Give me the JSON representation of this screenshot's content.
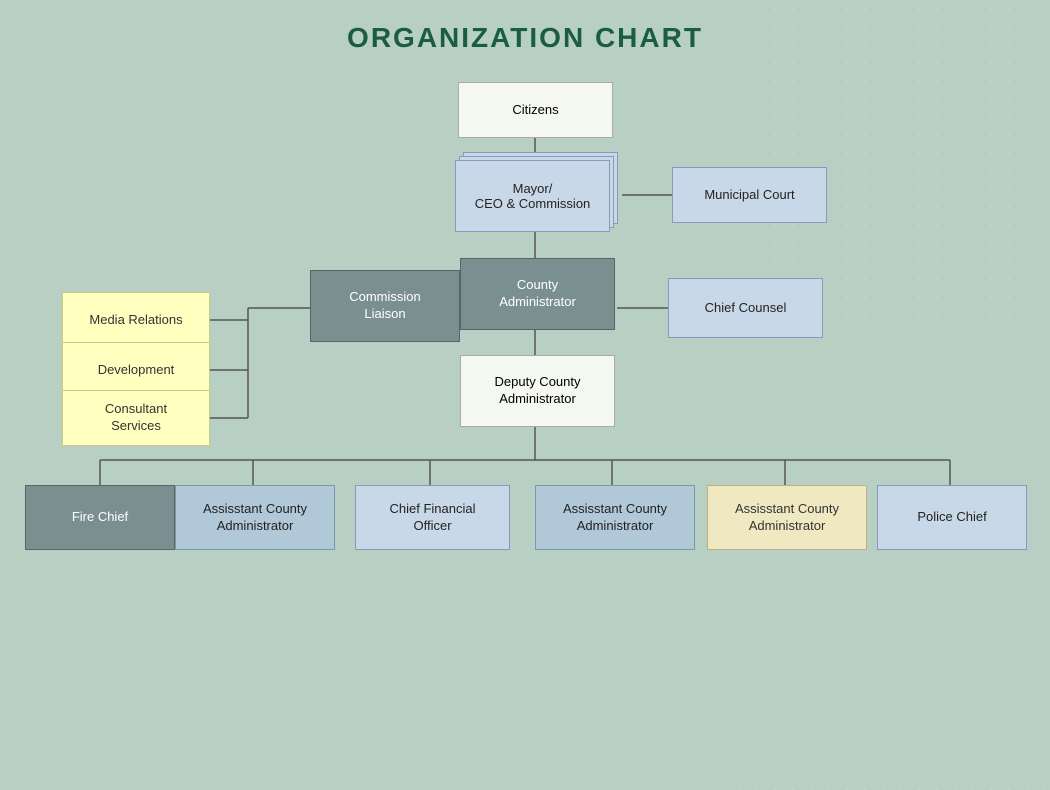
{
  "title": "ORGANIZATION CHART",
  "nodes": {
    "citizens": {
      "label": "Citizens"
    },
    "mayor": {
      "label": "Mayor/\nCEO & Commission"
    },
    "municipal_court": {
      "label": "Municipal Court"
    },
    "county_admin": {
      "label": "County\nAdministrator"
    },
    "commission_liaison": {
      "label": "Commission\nLiaison"
    },
    "chief_counsel": {
      "label": "Chief Counsel"
    },
    "media_relations": {
      "label": "Media Relations"
    },
    "development": {
      "label": "Development"
    },
    "consultant_services": {
      "label": "Consultant\nServices"
    },
    "deputy_county_admin": {
      "label": "Deputy County\nAdministrator"
    },
    "fire_chief": {
      "label": "Fire Chief"
    },
    "asst_admin_1": {
      "label": "Assisstant County\nAdministrator"
    },
    "cfo": {
      "label": "Chief Financial\nOfficer"
    },
    "asst_admin_2": {
      "label": "Assisstant County\nAdministrator"
    },
    "asst_admin_3": {
      "label": "Assisstant County\nAdministrator"
    },
    "police_chief": {
      "label": "Police Chief"
    }
  }
}
